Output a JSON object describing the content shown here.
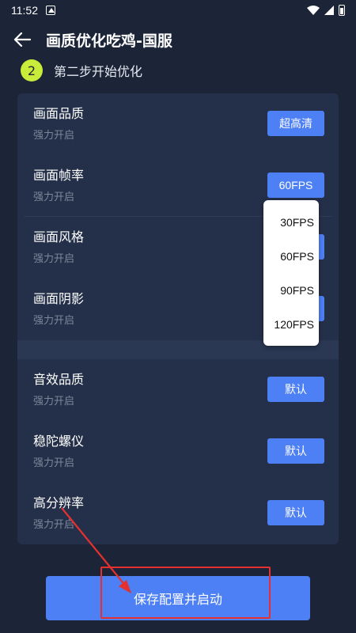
{
  "status_bar": {
    "time": "11:52"
  },
  "header": {
    "title": "画质优化吃鸡-国服"
  },
  "step": {
    "number": "2",
    "label": "第二步开始优化"
  },
  "settings": [
    {
      "title": "画面品质",
      "subtitle": "强力开启",
      "value": "超高清"
    },
    {
      "title": "画面帧率",
      "subtitle": "强力开启",
      "value": "60FPS"
    },
    {
      "title": "画面风格",
      "subtitle": "强力开启",
      "value": ""
    },
    {
      "title": "画面阴影",
      "subtitle": "强力开启",
      "value": ""
    },
    {
      "title": "音效品质",
      "subtitle": "强力开启",
      "value": "默认"
    },
    {
      "title": "稳陀螺仪",
      "subtitle": "强力开启",
      "value": "默认"
    },
    {
      "title": "高分辨率",
      "subtitle": "强力开启",
      "value": "默认"
    }
  ],
  "fps_dropdown": {
    "options": [
      "30FPS",
      "60FPS",
      "90FPS",
      "120FPS"
    ]
  },
  "save_button": {
    "label": "保存配置并启动"
  },
  "colors": {
    "background": "#1c2537",
    "panel": "#243049",
    "accent": "#4d7ff5",
    "step_badge": "#c9ec3a",
    "highlight": "#e53030"
  }
}
